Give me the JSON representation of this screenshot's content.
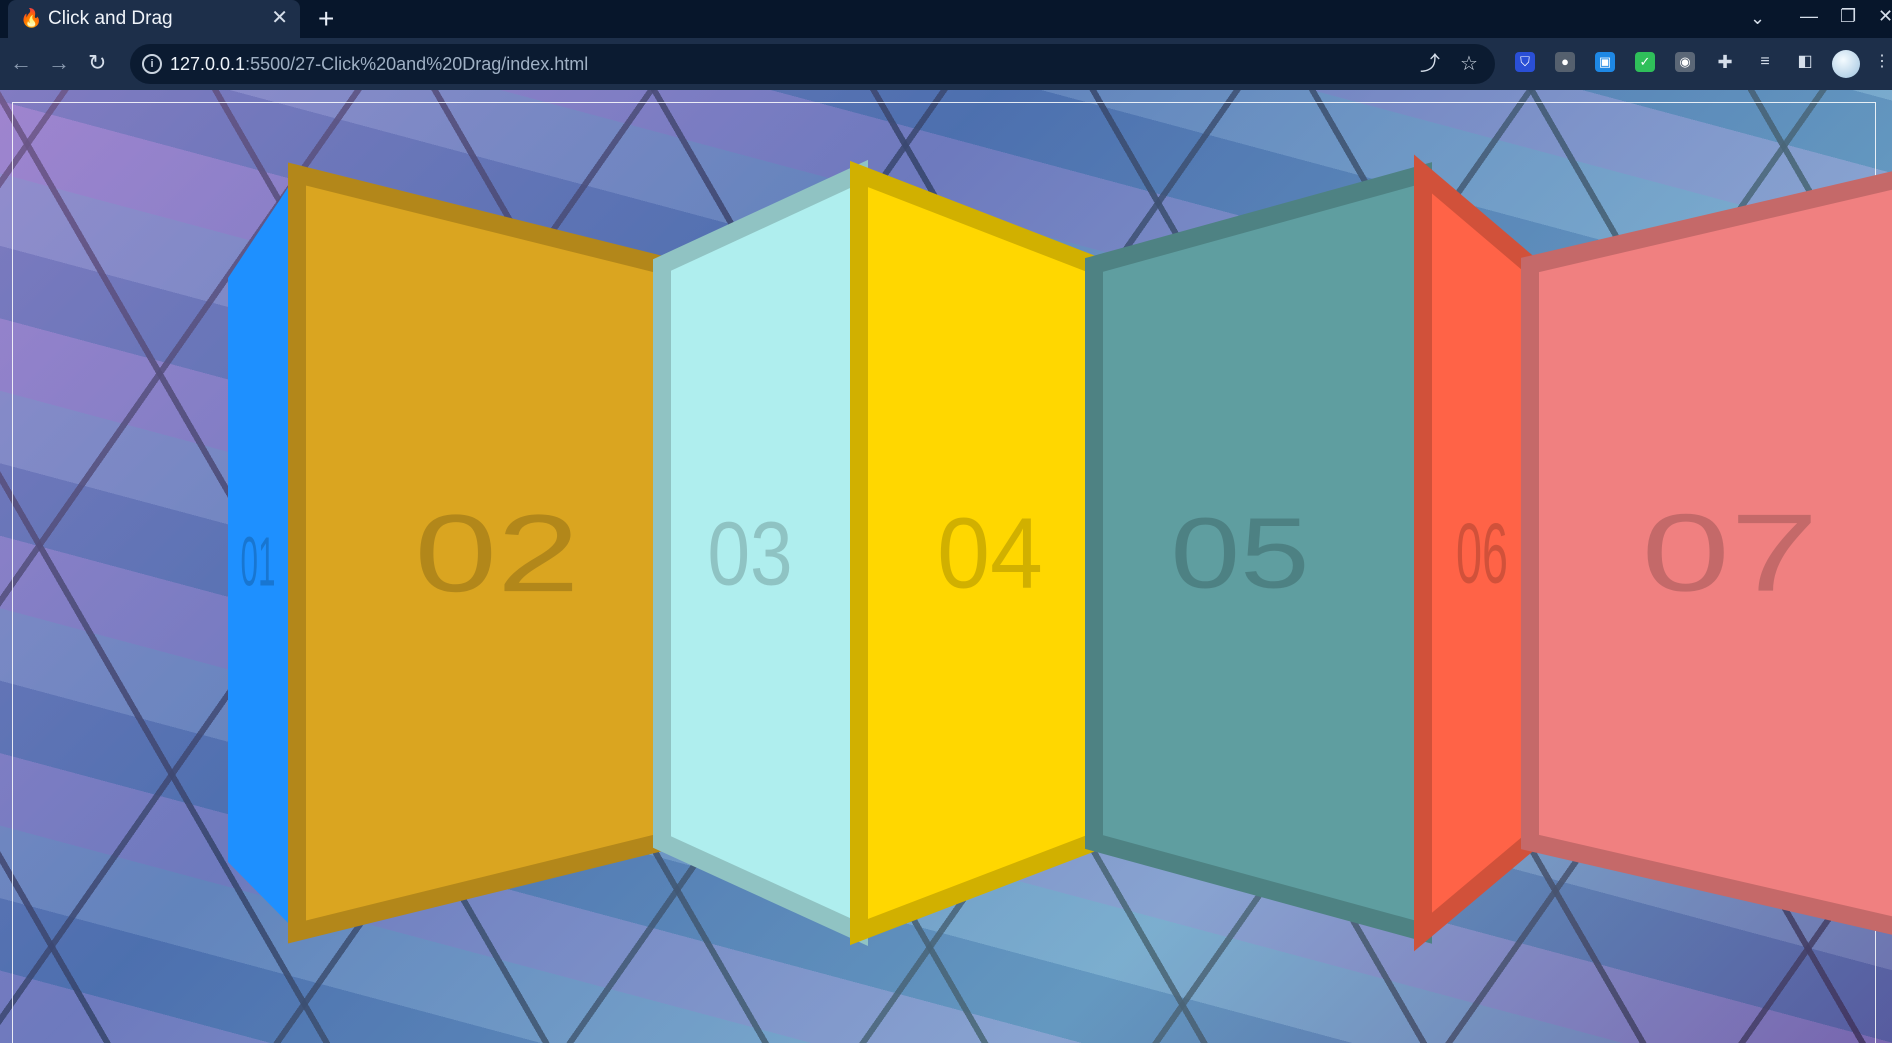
{
  "browser": {
    "tab_title": "Click and Drag",
    "tab_icon": "fire-icon",
    "url_host": "127.0.0.1",
    "url_rest": ":5500/27-Click%20and%20Drag/index.html"
  },
  "panels": [
    {
      "label": "01",
      "color": "#1E90FF"
    },
    {
      "label": "02",
      "color": "#DAA520"
    },
    {
      "label": "03",
      "color": "#AFEEEE"
    },
    {
      "label": "04",
      "color": "#FFD700"
    },
    {
      "label": "05",
      "color": "#5F9EA0"
    },
    {
      "label": "06",
      "color": "#FF6347"
    },
    {
      "label": "07",
      "color": "#F08080"
    }
  ]
}
